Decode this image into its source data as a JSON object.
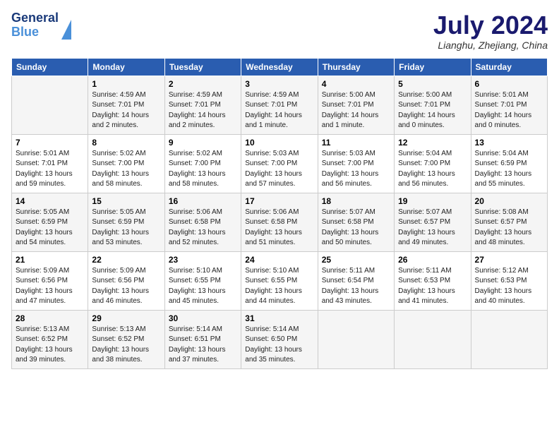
{
  "header": {
    "logo_line1": "General",
    "logo_line2": "Blue",
    "month_title": "July 2024",
    "location": "Lianghu, Zhejiang, China"
  },
  "days_of_week": [
    "Sunday",
    "Monday",
    "Tuesday",
    "Wednesday",
    "Thursday",
    "Friday",
    "Saturday"
  ],
  "weeks": [
    [
      {
        "day": "",
        "info": ""
      },
      {
        "day": "1",
        "info": "Sunrise: 4:59 AM\nSunset: 7:01 PM\nDaylight: 14 hours\nand 2 minutes."
      },
      {
        "day": "2",
        "info": "Sunrise: 4:59 AM\nSunset: 7:01 PM\nDaylight: 14 hours\nand 2 minutes."
      },
      {
        "day": "3",
        "info": "Sunrise: 4:59 AM\nSunset: 7:01 PM\nDaylight: 14 hours\nand 1 minute."
      },
      {
        "day": "4",
        "info": "Sunrise: 5:00 AM\nSunset: 7:01 PM\nDaylight: 14 hours\nand 1 minute."
      },
      {
        "day": "5",
        "info": "Sunrise: 5:00 AM\nSunset: 7:01 PM\nDaylight: 14 hours\nand 0 minutes."
      },
      {
        "day": "6",
        "info": "Sunrise: 5:01 AM\nSunset: 7:01 PM\nDaylight: 14 hours\nand 0 minutes."
      }
    ],
    [
      {
        "day": "7",
        "info": "Sunrise: 5:01 AM\nSunset: 7:01 PM\nDaylight: 13 hours\nand 59 minutes."
      },
      {
        "day": "8",
        "info": "Sunrise: 5:02 AM\nSunset: 7:00 PM\nDaylight: 13 hours\nand 58 minutes."
      },
      {
        "day": "9",
        "info": "Sunrise: 5:02 AM\nSunset: 7:00 PM\nDaylight: 13 hours\nand 58 minutes."
      },
      {
        "day": "10",
        "info": "Sunrise: 5:03 AM\nSunset: 7:00 PM\nDaylight: 13 hours\nand 57 minutes."
      },
      {
        "day": "11",
        "info": "Sunrise: 5:03 AM\nSunset: 7:00 PM\nDaylight: 13 hours\nand 56 minutes."
      },
      {
        "day": "12",
        "info": "Sunrise: 5:04 AM\nSunset: 7:00 PM\nDaylight: 13 hours\nand 56 minutes."
      },
      {
        "day": "13",
        "info": "Sunrise: 5:04 AM\nSunset: 6:59 PM\nDaylight: 13 hours\nand 55 minutes."
      }
    ],
    [
      {
        "day": "14",
        "info": "Sunrise: 5:05 AM\nSunset: 6:59 PM\nDaylight: 13 hours\nand 54 minutes."
      },
      {
        "day": "15",
        "info": "Sunrise: 5:05 AM\nSunset: 6:59 PM\nDaylight: 13 hours\nand 53 minutes."
      },
      {
        "day": "16",
        "info": "Sunrise: 5:06 AM\nSunset: 6:58 PM\nDaylight: 13 hours\nand 52 minutes."
      },
      {
        "day": "17",
        "info": "Sunrise: 5:06 AM\nSunset: 6:58 PM\nDaylight: 13 hours\nand 51 minutes."
      },
      {
        "day": "18",
        "info": "Sunrise: 5:07 AM\nSunset: 6:58 PM\nDaylight: 13 hours\nand 50 minutes."
      },
      {
        "day": "19",
        "info": "Sunrise: 5:07 AM\nSunset: 6:57 PM\nDaylight: 13 hours\nand 49 minutes."
      },
      {
        "day": "20",
        "info": "Sunrise: 5:08 AM\nSunset: 6:57 PM\nDaylight: 13 hours\nand 48 minutes."
      }
    ],
    [
      {
        "day": "21",
        "info": "Sunrise: 5:09 AM\nSunset: 6:56 PM\nDaylight: 13 hours\nand 47 minutes."
      },
      {
        "day": "22",
        "info": "Sunrise: 5:09 AM\nSunset: 6:56 PM\nDaylight: 13 hours\nand 46 minutes."
      },
      {
        "day": "23",
        "info": "Sunrise: 5:10 AM\nSunset: 6:55 PM\nDaylight: 13 hours\nand 45 minutes."
      },
      {
        "day": "24",
        "info": "Sunrise: 5:10 AM\nSunset: 6:55 PM\nDaylight: 13 hours\nand 44 minutes."
      },
      {
        "day": "25",
        "info": "Sunrise: 5:11 AM\nSunset: 6:54 PM\nDaylight: 13 hours\nand 43 minutes."
      },
      {
        "day": "26",
        "info": "Sunrise: 5:11 AM\nSunset: 6:53 PM\nDaylight: 13 hours\nand 41 minutes."
      },
      {
        "day": "27",
        "info": "Sunrise: 5:12 AM\nSunset: 6:53 PM\nDaylight: 13 hours\nand 40 minutes."
      }
    ],
    [
      {
        "day": "28",
        "info": "Sunrise: 5:13 AM\nSunset: 6:52 PM\nDaylight: 13 hours\nand 39 minutes."
      },
      {
        "day": "29",
        "info": "Sunrise: 5:13 AM\nSunset: 6:52 PM\nDaylight: 13 hours\nand 38 minutes."
      },
      {
        "day": "30",
        "info": "Sunrise: 5:14 AM\nSunset: 6:51 PM\nDaylight: 13 hours\nand 37 minutes."
      },
      {
        "day": "31",
        "info": "Sunrise: 5:14 AM\nSunset: 6:50 PM\nDaylight: 13 hours\nand 35 minutes."
      },
      {
        "day": "",
        "info": ""
      },
      {
        "day": "",
        "info": ""
      },
      {
        "day": "",
        "info": ""
      }
    ]
  ]
}
